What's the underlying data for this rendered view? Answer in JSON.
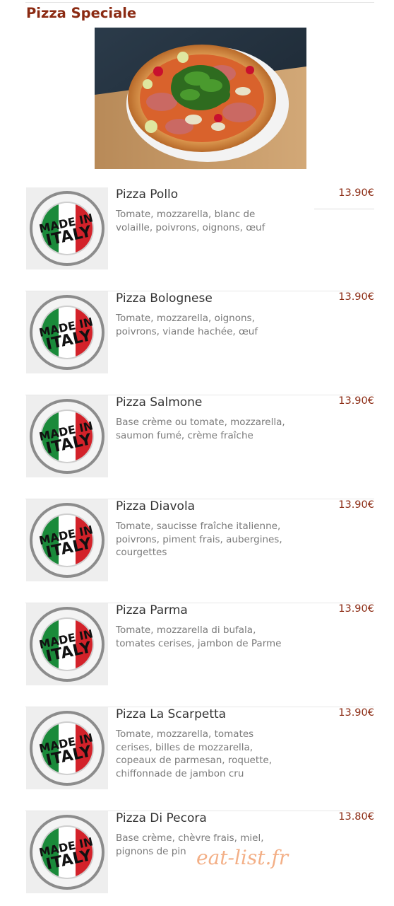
{
  "section": {
    "title": "Pizza Speciale"
  },
  "items": [
    {
      "name": "Pizza Pollo",
      "description": "Tomate, mozzarella, blanc de volaille, poivrons, oignons, œuf",
      "price": "13.90€"
    },
    {
      "name": "Pizza Bolognese",
      "description": "Tomate, mozzarella, oignons, poivrons, viande hachée, œuf",
      "price": "13.90€"
    },
    {
      "name": "Pizza Salmone",
      "description": "Base crème ou tomate, mozzarella, saumon fumé, crème fraîche",
      "price": "13.90€"
    },
    {
      "name": "Pizza Diavola",
      "description": "Tomate, saucisse fraîche italienne, poivrons, piment frais, aubergines, courgettes",
      "price": "13.90€"
    },
    {
      "name": "Pizza Parma",
      "description": "Tomate, mozzarella di bufala, tomates cerises, jambon de Parme",
      "price": "13.90€"
    },
    {
      "name": "Pizza La Scarpetta",
      "description": "Tomate, mozzarella, tomates cerises, billes de mozzarella, copeaux de parmesan, roquette, chiffonnade de jambon cru",
      "price": "13.90€"
    },
    {
      "name": "Pizza Di Pecora",
      "description": "Base crème, chèvre frais, miel, pignons de pin",
      "price": "13.80€"
    }
  ],
  "badge": {
    "top_text": "MADE IN ITALY",
    "line1": "MADE IN",
    "line2": "ITALY"
  },
  "watermark": "eat-list.fr",
  "colors": {
    "accent": "#8b2a12",
    "italy_green": "#1a8a3a",
    "italy_red": "#d3222a"
  }
}
